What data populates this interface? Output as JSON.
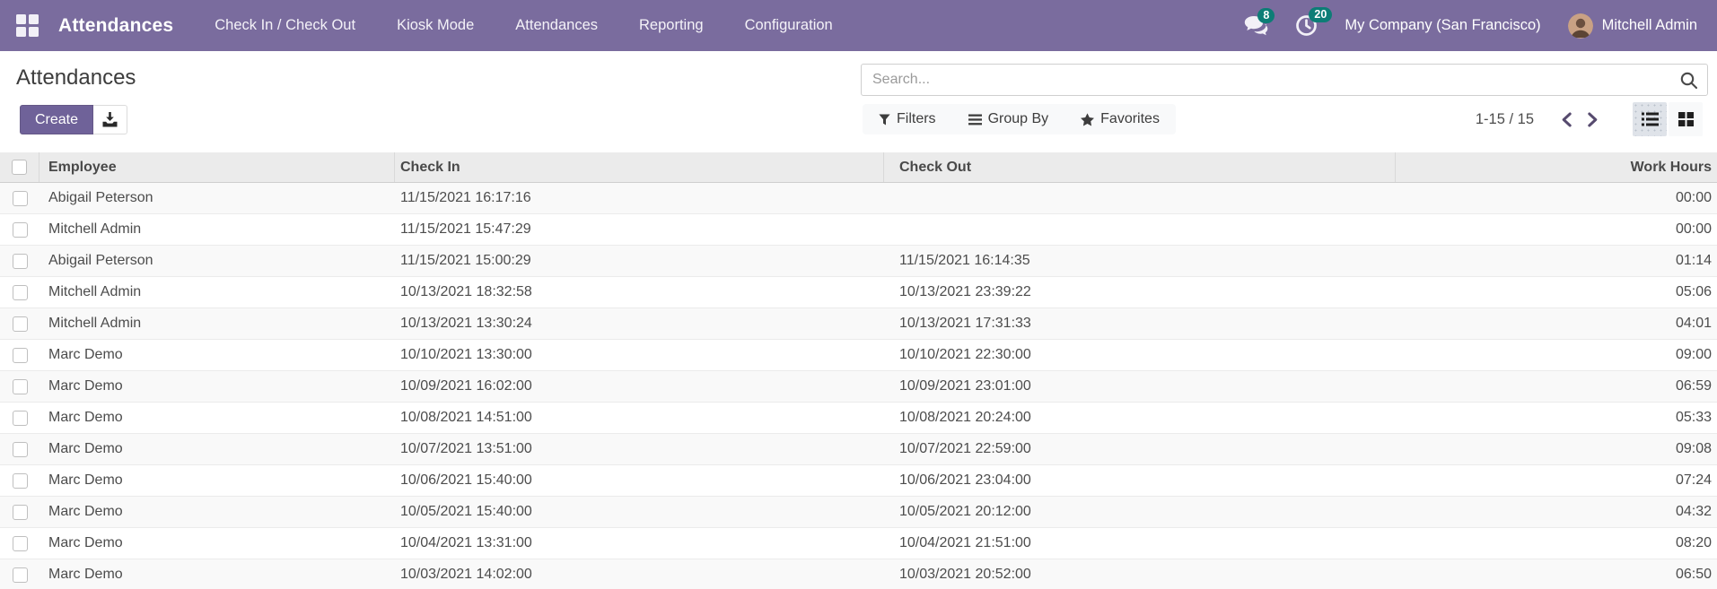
{
  "colors": {
    "navbar_bg": "#7a6c9e",
    "primary_button_bg": "#6f6299",
    "badge_bg": "#0d7d76",
    "table_header_bg": "#ebebeb",
    "row_stripe_bg": "#f9f9f9"
  },
  "navbar": {
    "app_name": "Attendances",
    "menu_items": [
      "Check In / Check Out",
      "Kiosk Mode",
      "Attendances",
      "Reporting",
      "Configuration"
    ],
    "messages_badge": "8",
    "activities_badge": "20",
    "company_name": "My Company (San Francisco)",
    "user_name": "Mitchell Admin"
  },
  "control_panel": {
    "title": "Attendances",
    "create_label": "Create",
    "search_placeholder": "Search...",
    "filters_label": "Filters",
    "group_by_label": "Group By",
    "favorites_label": "Favorites",
    "pager_text": "1-15 / 15"
  },
  "icons": {
    "apps": "grid-2x2",
    "messages": "chat-bubbles",
    "activities": "clock",
    "export": "download-tray",
    "search": "magnifier",
    "filters": "funnel",
    "group_by": "horizontal-bars",
    "favorites": "star",
    "pager_previous": "chevron-left",
    "pager_next": "chevron-right",
    "list_view": "list-ul",
    "kanban_view": "four-squares"
  },
  "table": {
    "columns": [
      {
        "key": "employee",
        "label": "Employee"
      },
      {
        "key": "check_in",
        "label": "Check In"
      },
      {
        "key": "check_out",
        "label": "Check Out"
      },
      {
        "key": "work_hours",
        "label": "Work Hours"
      }
    ],
    "rows": [
      {
        "employee": "Abigail Peterson",
        "check_in": "11/15/2021 16:17:16",
        "check_out": "",
        "work_hours": "00:00"
      },
      {
        "employee": "Mitchell Admin",
        "check_in": "11/15/2021 15:47:29",
        "check_out": "",
        "work_hours": "00:00"
      },
      {
        "employee": "Abigail Peterson",
        "check_in": "11/15/2021 15:00:29",
        "check_out": "11/15/2021 16:14:35",
        "work_hours": "01:14"
      },
      {
        "employee": "Mitchell Admin",
        "check_in": "10/13/2021 18:32:58",
        "check_out": "10/13/2021 23:39:22",
        "work_hours": "05:06"
      },
      {
        "employee": "Mitchell Admin",
        "check_in": "10/13/2021 13:30:24",
        "check_out": "10/13/2021 17:31:33",
        "work_hours": "04:01"
      },
      {
        "employee": "Marc Demo",
        "check_in": "10/10/2021 13:30:00",
        "check_out": "10/10/2021 22:30:00",
        "work_hours": "09:00"
      },
      {
        "employee": "Marc Demo",
        "check_in": "10/09/2021 16:02:00",
        "check_out": "10/09/2021 23:01:00",
        "work_hours": "06:59"
      },
      {
        "employee": "Marc Demo",
        "check_in": "10/08/2021 14:51:00",
        "check_out": "10/08/2021 20:24:00",
        "work_hours": "05:33"
      },
      {
        "employee": "Marc Demo",
        "check_in": "10/07/2021 13:51:00",
        "check_out": "10/07/2021 22:59:00",
        "work_hours": "09:08"
      },
      {
        "employee": "Marc Demo",
        "check_in": "10/06/2021 15:40:00",
        "check_out": "10/06/2021 23:04:00",
        "work_hours": "07:24"
      },
      {
        "employee": "Marc Demo",
        "check_in": "10/05/2021 15:40:00",
        "check_out": "10/05/2021 20:12:00",
        "work_hours": "04:32"
      },
      {
        "employee": "Marc Demo",
        "check_in": "10/04/2021 13:31:00",
        "check_out": "10/04/2021 21:51:00",
        "work_hours": "08:20"
      },
      {
        "employee": "Marc Demo",
        "check_in": "10/03/2021 14:02:00",
        "check_out": "10/03/2021 20:52:00",
        "work_hours": "06:50"
      }
    ]
  }
}
